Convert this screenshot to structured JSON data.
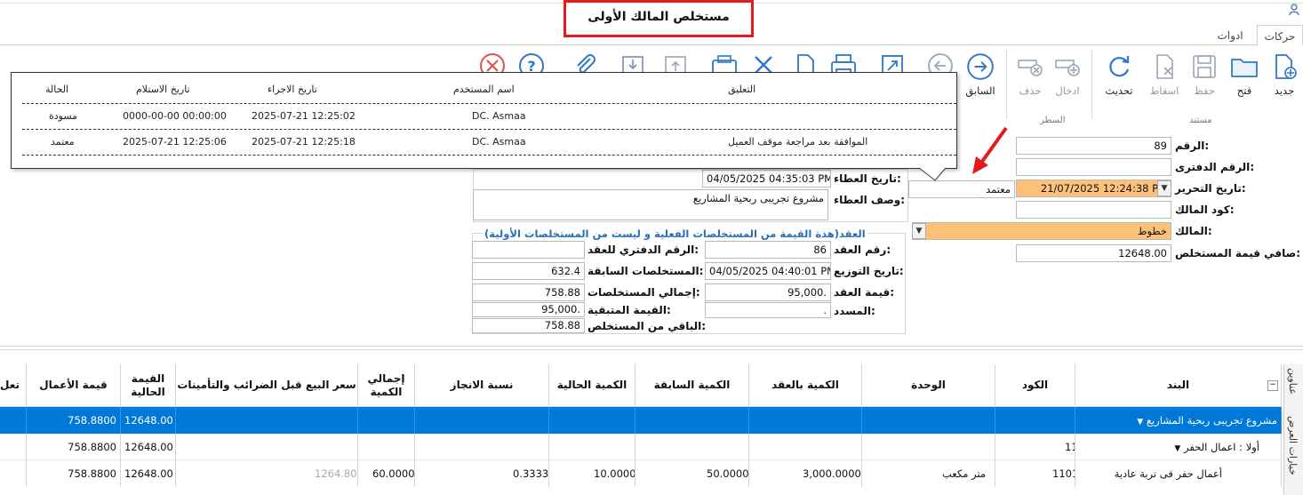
{
  "window": {
    "title": "مستخلص المالك الأولى"
  },
  "tabs": [
    "حركات",
    "ادوات"
  ],
  "ribbon": {
    "left_icons": [
      "close-circle-icon",
      "help-circle-icon",
      "attach-icon",
      "import-icon",
      "export-icon",
      "fax-icon",
      "tools-icon",
      "document-icon",
      "print-icon",
      "expand-icon",
      "back-arrow-icon",
      "next-arrow-icon"
    ],
    "prev_label": "السابق",
    "row_buttons": [
      {
        "label": "حذف",
        "icon": "delete-row-icon",
        "enabled": false
      },
      {
        "label": "ادخال",
        "icon": "insert-row-icon",
        "enabled": false
      }
    ],
    "row_group": "السطر",
    "doc_buttons": [
      {
        "label": "تحديث",
        "icon": "refresh-icon",
        "enabled": true
      },
      {
        "label": "اسقاط",
        "icon": "discard-icon",
        "enabled": false
      },
      {
        "label": "حفظ",
        "icon": "save-icon",
        "enabled": false
      },
      {
        "label": "فتح",
        "icon": "folder-icon",
        "enabled": true
      },
      {
        "label": "جديد",
        "icon": "new-document-icon",
        "enabled": true
      }
    ],
    "doc_group": "مستند"
  },
  "status_popup": {
    "headers": {
      "status": "الحالة",
      "receive_date": "تاريخ الاستلام",
      "action_date": "تاريخ الاجراء",
      "user": "اسم المستخدم",
      "comment": "التعليق"
    },
    "rows": [
      {
        "status": "مسودة",
        "receive_date": "0000-00-00 00:00:00",
        "action_date": "2025-07-21 12:25:02",
        "user": "DC. Asmaa",
        "comment": ""
      },
      {
        "status": "معتمد",
        "receive_date": "2025-07-21 12:25:06",
        "action_date": "2025-07-21 12:25:18",
        "user": "DC. Asmaa",
        "comment": "الموافقة بعد مراجعة موقف العميل"
      }
    ]
  },
  "form": {
    "number": {
      "label": "الرقم:",
      "value": "89"
    },
    "ledger_number": {
      "label": "الرقم الدفترى:",
      "value": ""
    },
    "edit_date": {
      "label": "تاريخ التحرير:",
      "value": "21/07/2025 12:24:38 PM"
    },
    "owner_code": {
      "label": "كود المالك:",
      "value": ""
    },
    "owner": {
      "label": "المالك:",
      "value": "خطوط"
    },
    "net_value": {
      "label": "صافي قيمة المستخلص:",
      "value": "12648.00"
    },
    "status_value": "معتمد",
    "tender_date": {
      "label": "تاريخ العطاء:",
      "value": "04/05/2025 04:35:03 PM"
    },
    "tender_desc": {
      "label": "وصف العطاء:",
      "value": "مشروع تجريبى ربحية المشاريع"
    }
  },
  "contract": {
    "title": "العقد(هذة القيمة من المستخلصات الفعلية و ليست من المستخلصات الأولية)",
    "contract_no": {
      "label": "رقم العقد:",
      "value": "86"
    },
    "ledger_no": {
      "label": "الرقم الدفتري للعقد:",
      "value": ""
    },
    "distribution_date": {
      "label": "تاريخ التوزيع:",
      "value": "04/05/2025 04:40:01 PM"
    },
    "prev_extracts": {
      "label": "المستخلصات السابقة:",
      "value": "632.4"
    },
    "contract_value": {
      "label": "قيمة العقد:",
      "value": "95,000."
    },
    "total_extracts": {
      "label": "إجمالي المستخلصات:",
      "value": "758.88"
    },
    "paid": {
      "label": "المسدد:",
      "value": "."
    },
    "remaining_value": {
      "label": "القيمة المتبقية:",
      "value": "95,000."
    },
    "remaining_extract": {
      "label": "الباقي من المستخلص:",
      "value": "758.88"
    }
  },
  "grid": {
    "headers": {
      "item": "البند",
      "code": "الكود",
      "unit": "الوحدة",
      "contract_qty": "الكمية بالعقد",
      "prev_qty": "الكمية السابقة",
      "current_qty": "الكمية الحالية",
      "progress": "نسبة الانجاز",
      "total_qty": "إجمالي الكمية",
      "price": "سعر البيع قبل الضرائب والتأمينات",
      "current_value": "القيمة الحالية",
      "works_value": "قيمة الأعمال",
      "notes": "تعل"
    },
    "rows": [
      {
        "item": "مشروع تجريبى ربحية المشاريع",
        "code": "",
        "unit": "",
        "contract_qty": "",
        "prev_qty": "",
        "current_qty": "",
        "progress": "",
        "total_qty": "",
        "price": "",
        "current_value": "12648.00",
        "works_value": "758.8800"
      },
      {
        "item": "أولا : اعمال الحفر",
        "code": "11",
        "unit": "",
        "contract_qty": "",
        "prev_qty": "",
        "current_qty": "",
        "progress": "",
        "total_qty": "",
        "price": "",
        "current_value": "12648.00",
        "works_value": "758.8800"
      },
      {
        "item": "أعمال حفر فى تربة عادية",
        "code": "1101",
        "unit": "متر مكعب",
        "contract_qty": "3,000.0000",
        "prev_qty": "50.0000",
        "current_qty": "10.0000",
        "progress": "0.3333",
        "total_qty": "60.0000",
        "price": "1264.80",
        "current_value": "12648.00",
        "works_value": "758.8800"
      }
    ],
    "side_tabs": [
      "عناوين",
      "خيارات العرض"
    ]
  },
  "colors": {
    "selection": "#0078d7",
    "highlight_field": "#fdc177",
    "annotation": "#e61a1a",
    "group_title": "#2a6db8"
  }
}
